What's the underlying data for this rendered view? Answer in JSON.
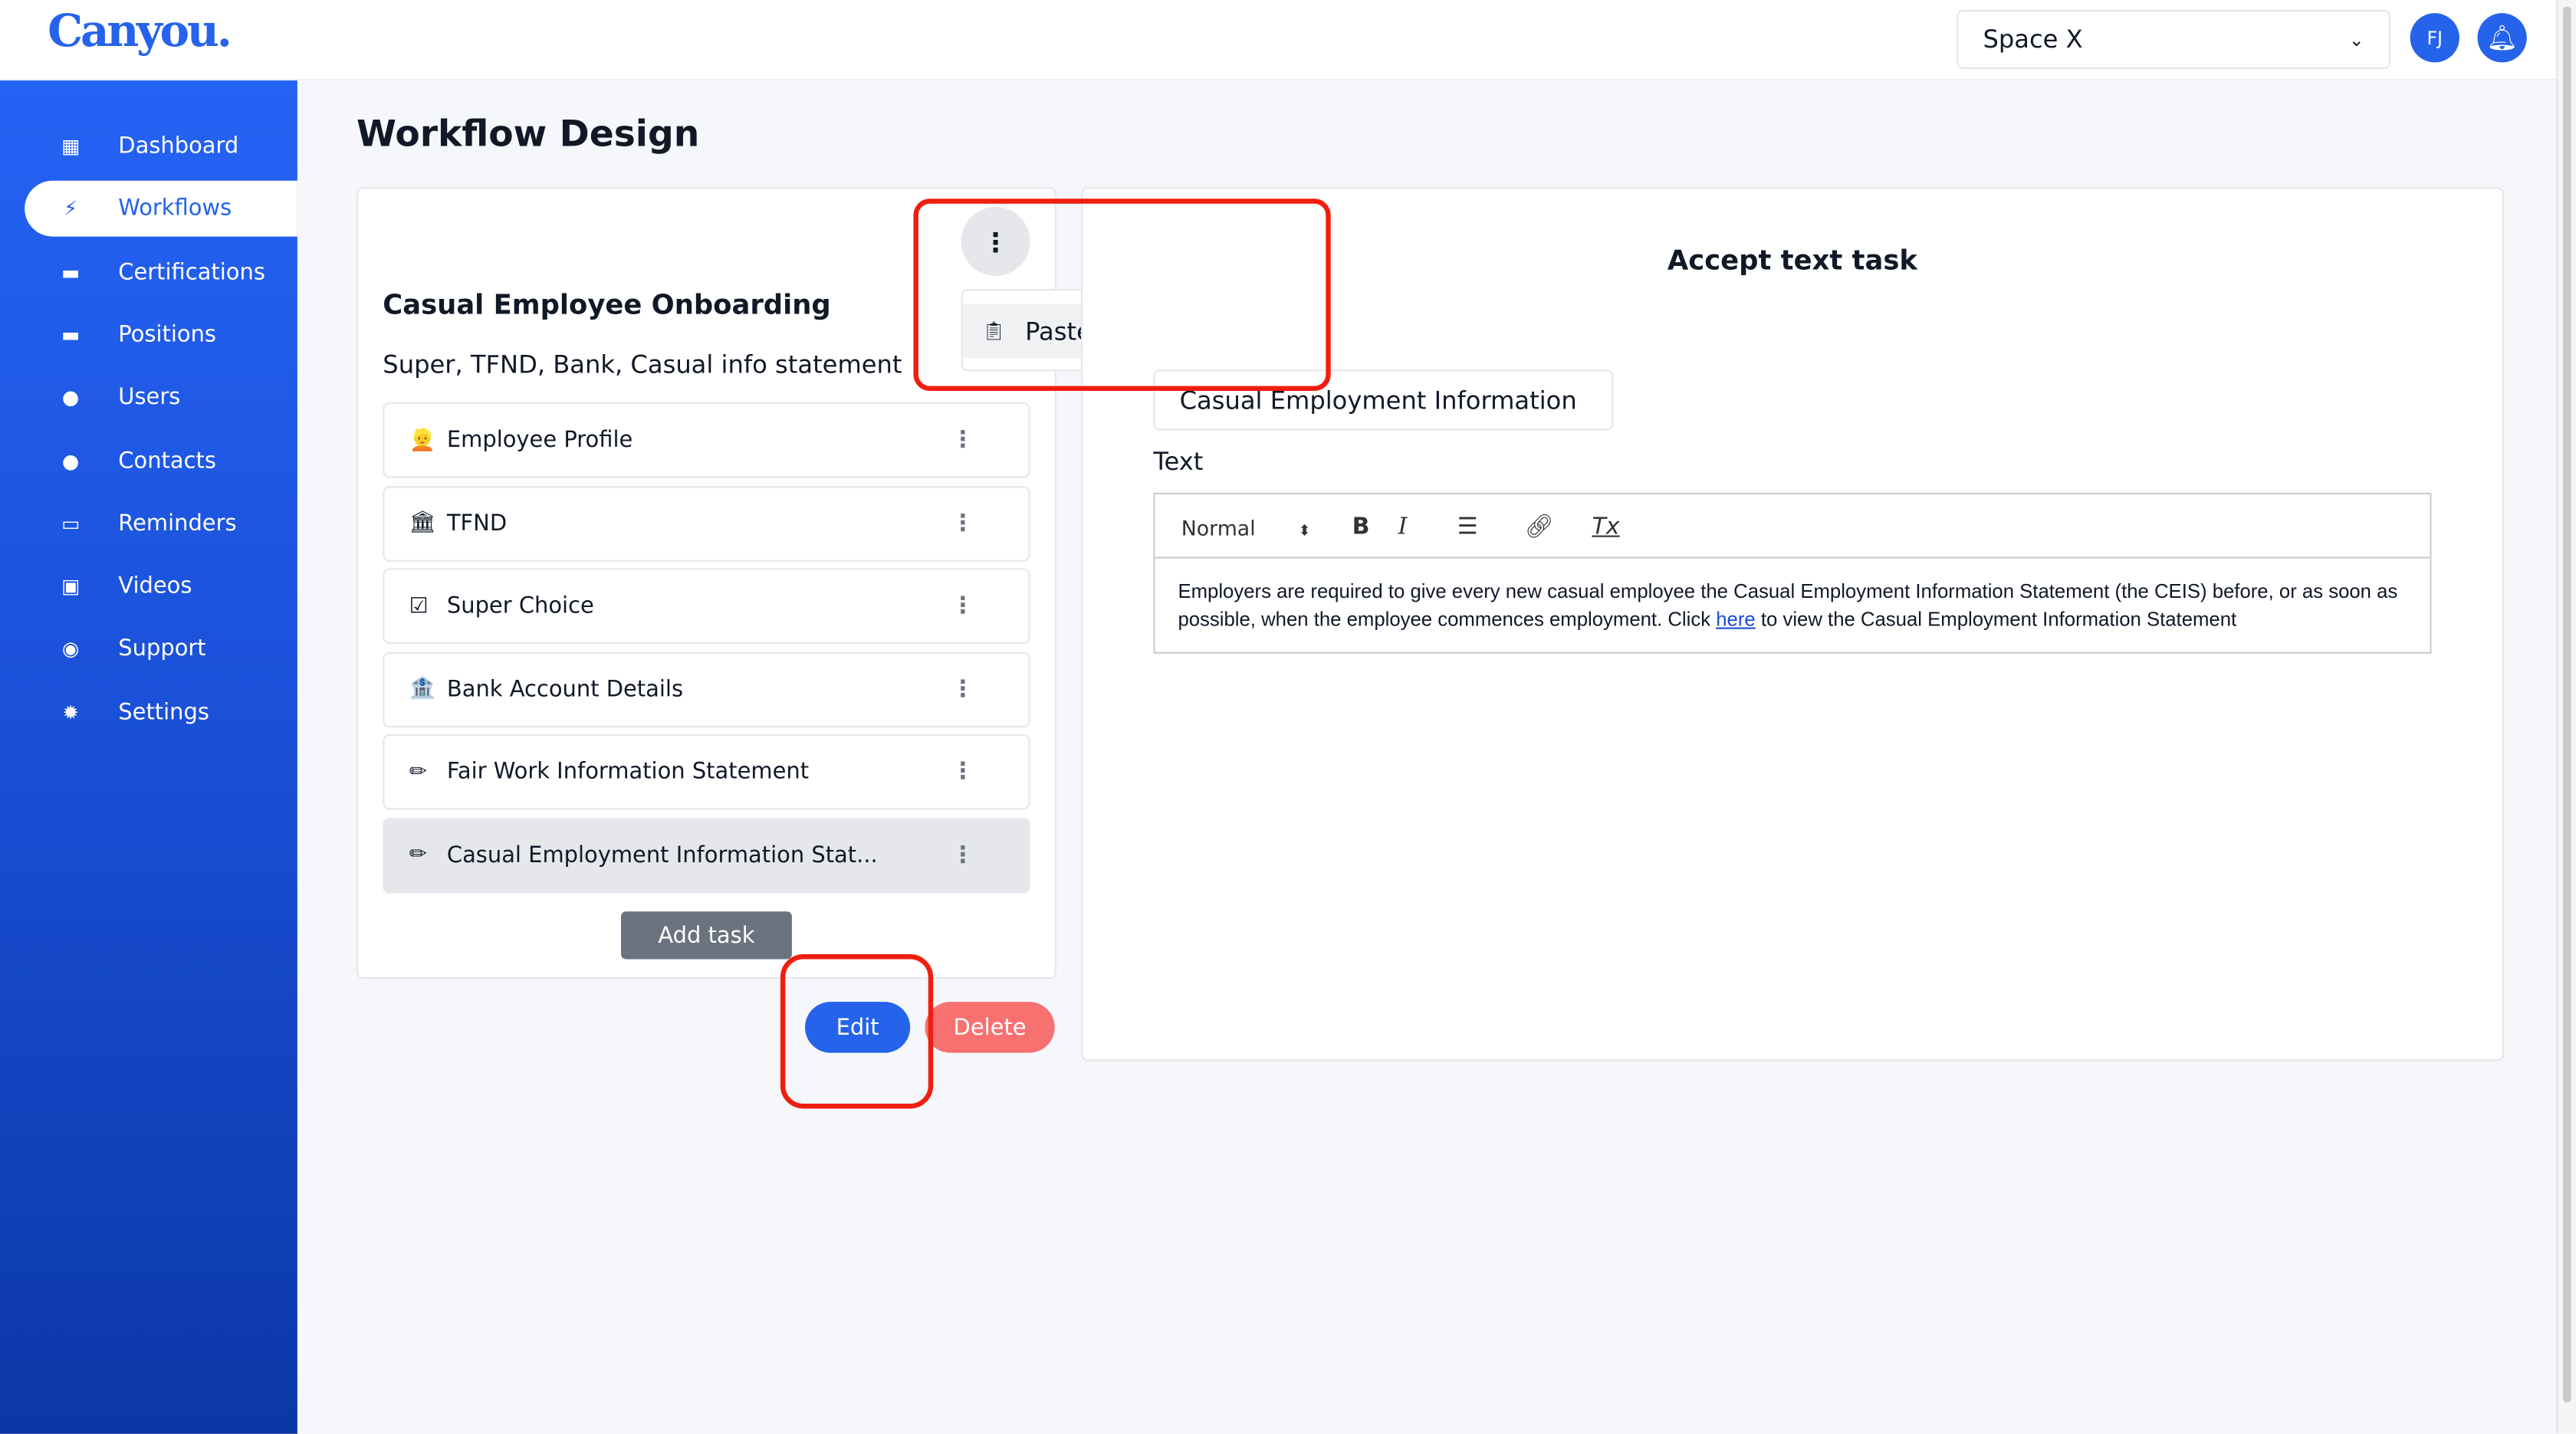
{
  "header": {
    "logo": "Canyou.",
    "workspace": "Space X",
    "avatar_initials": "FJ",
    "bell_icon": "bell-icon"
  },
  "sidebar": {
    "items": [
      {
        "label": "Dashboard",
        "icon": "▦"
      },
      {
        "label": "Workflows",
        "icon": "⚡",
        "active": true
      },
      {
        "label": "Certifications",
        "icon": "▬"
      },
      {
        "label": "Positions",
        "icon": "▬"
      },
      {
        "label": "Users",
        "icon": "●"
      },
      {
        "label": "Contacts",
        "icon": "●"
      },
      {
        "label": "Reminders",
        "icon": "▭"
      },
      {
        "label": "Videos",
        "icon": "▣"
      },
      {
        "label": "Support",
        "icon": "◉"
      },
      {
        "label": "Settings",
        "icon": "✹"
      }
    ]
  },
  "page": {
    "title": "Workflow Design"
  },
  "workflow": {
    "name": "Casual Employee Onboarding",
    "description": "Super, TFND, Bank, Casual info statement",
    "tasks": [
      {
        "emoji": "👱",
        "label": "Employee Profile"
      },
      {
        "emoji": "🏛",
        "label": "TFND"
      },
      {
        "emoji": "☑",
        "label": "Super Choice"
      },
      {
        "emoji": "🏦",
        "label": "Bank Account Details"
      },
      {
        "emoji": "✏",
        "label": "Fair Work Information Statement"
      },
      {
        "emoji": "✏",
        "label": "Casual Employment Information Stat...",
        "selected": true
      }
    ],
    "add_task": "Add task",
    "edit": "Edit",
    "delete": "Delete"
  },
  "menu": {
    "items": [
      {
        "label": "Paste form task",
        "icon": "clipboard-icon"
      }
    ]
  },
  "task_editor": {
    "heading": "Accept text task",
    "title_value": "Casual Employment Information",
    "text_label": "Text",
    "toolbar": {
      "format": "Normal",
      "bold": "B",
      "italic": "I",
      "clear": "Tx"
    },
    "body_before": "Employers are required to give every new casual employee the Casual Employment Information Statement (the CEIS) before, or as soon as possible, when the employee commences employment. Click ",
    "link": "here",
    "body_after": " to view the Casual Employment Information Statement"
  },
  "colors": {
    "accent": "#2563eb",
    "delete": "#f87171",
    "annotation": "#f01e0f"
  }
}
